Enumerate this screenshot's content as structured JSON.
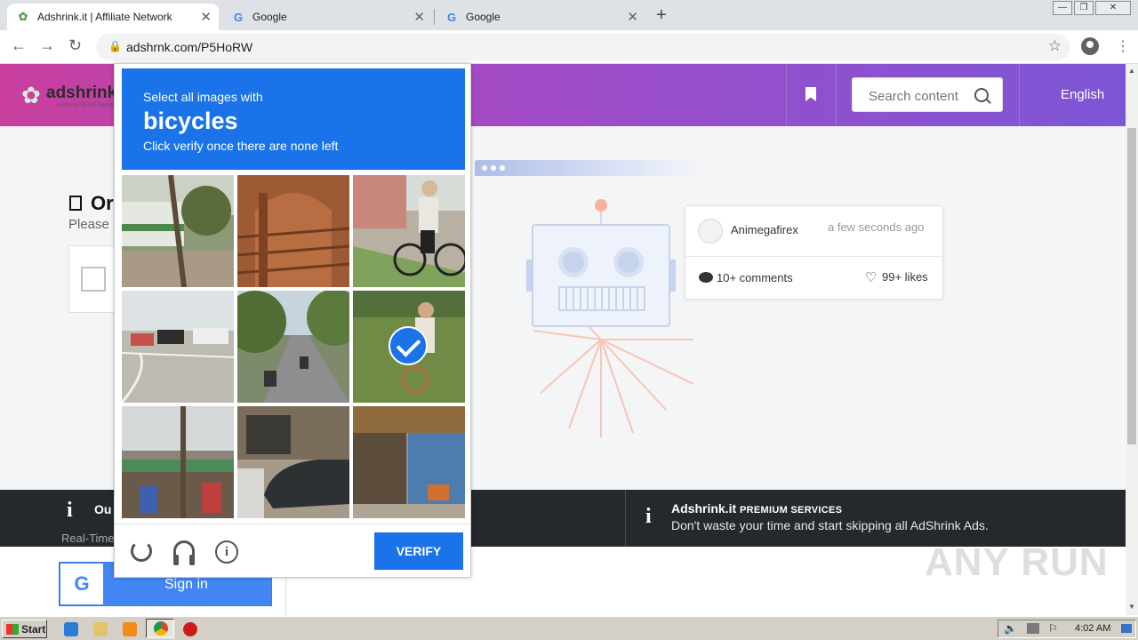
{
  "browser": {
    "tabs": [
      {
        "title": "Adshrink.it | Affiliate Network",
        "favicon": "adshrink-bird-icon",
        "active": true
      },
      {
        "title": "Google",
        "favicon": "google-g-icon",
        "active": false
      },
      {
        "title": "Google",
        "favicon": "google-g-icon",
        "active": false
      }
    ],
    "new_tab_symbol": "+",
    "url": "adshrnk.com/P5HoRW"
  },
  "site": {
    "logo_text": "adshrink.it",
    "logo_sub": "AFFILIATE NETWORK",
    "search_placeholder": "Search content",
    "language": "English"
  },
  "page": {
    "heading_partial": "Or",
    "please_partial": "Please"
  },
  "notification": {
    "user": "Animegafirex",
    "time": "a few seconds ago",
    "comments": "10+ comments",
    "likes": "99+ likes"
  },
  "footer_band": {
    "left_title": "Ou",
    "left_sub": "Real-Time",
    "right_brand": "Adshrink.it",
    "right_title_suffix": "PREMIUM SERVICES",
    "right_sub": "Don't waste your time and start skipping all AdShrink Ads."
  },
  "signin": {
    "label": "Sign in",
    "g": "G"
  },
  "captcha": {
    "line1": "Select all images with",
    "line2": "bicycles",
    "line3": "Click verify once there are none left",
    "verify_label": "VERIFY",
    "tiles": [
      {
        "name": "tile-bus-street",
        "selected": false
      },
      {
        "name": "tile-brick-wall",
        "selected": false
      },
      {
        "name": "tile-cyclist",
        "selected": false
      },
      {
        "name": "tile-intersection",
        "selected": false
      },
      {
        "name": "tile-scooters-road",
        "selected": false
      },
      {
        "name": "tile-cyclist-grass",
        "selected": true
      },
      {
        "name": "tile-market-stall",
        "selected": false
      },
      {
        "name": "tile-parked-car",
        "selected": false
      },
      {
        "name": "tile-shop-front",
        "selected": false
      }
    ]
  },
  "watermark": "ANY RUN",
  "taskbar": {
    "start_label": "Start",
    "clock": "4:02 AM"
  },
  "colors": {
    "captcha_blue": "#1a73e8",
    "header_gradient_start": "#c93f9e",
    "header_gradient_end": "#7d56d6",
    "dark_band": "#25282c"
  }
}
